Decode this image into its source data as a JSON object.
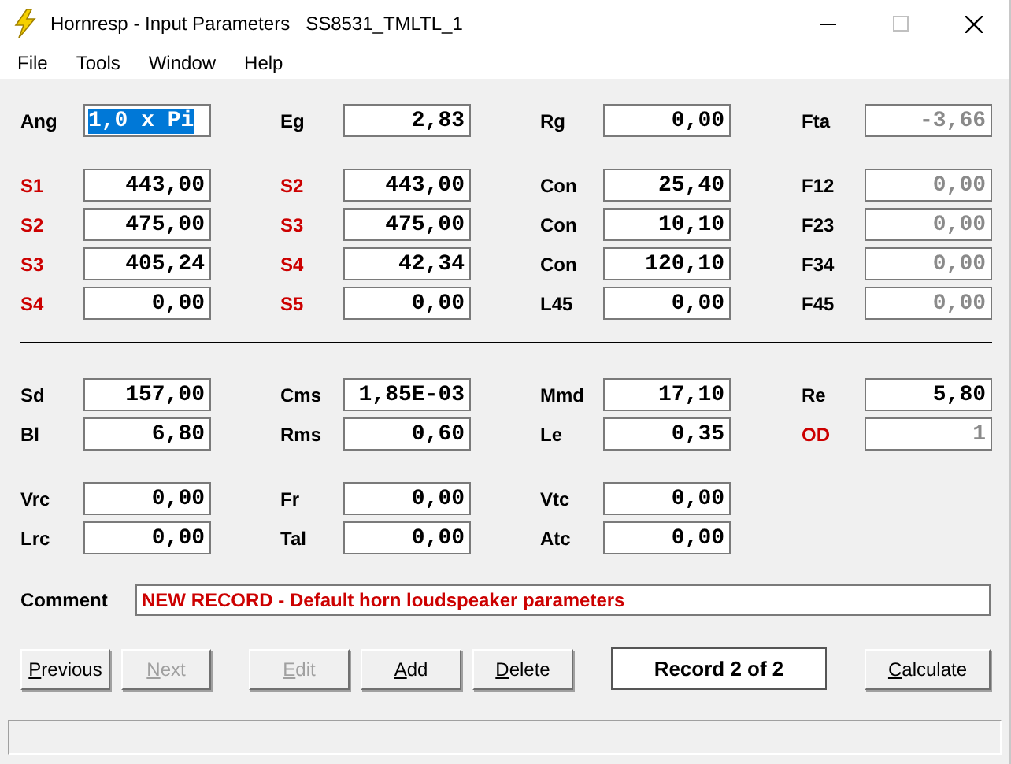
{
  "window": {
    "title": "Hornresp - Input Parameters",
    "document": "SS8531_TMLTL_1"
  },
  "menu": [
    "File",
    "Tools",
    "Window",
    "Help"
  ],
  "groups": [
    {
      "divider_before": false,
      "rows": [
        [
          {
            "label": "Ang",
            "color": "#000000",
            "value": "1,0 x Pi",
            "disabled": false,
            "selected": true
          },
          {
            "label": "Eg",
            "color": "#000000",
            "value": "2,83",
            "disabled": false,
            "selected": false
          },
          {
            "label": "Rg",
            "color": "#000000",
            "value": "0,00",
            "disabled": false,
            "selected": false
          },
          {
            "label": "Fta",
            "color": "#000000",
            "value": "-3,66",
            "disabled": true,
            "selected": false
          }
        ]
      ]
    },
    {
      "divider_before": false,
      "rows": [
        [
          {
            "label": "S1",
            "color": "#cc0000",
            "value": "443,00",
            "disabled": false,
            "selected": false
          },
          {
            "label": "S2",
            "color": "#cc0000",
            "value": "443,00",
            "disabled": false,
            "selected": false
          },
          {
            "label": "Con",
            "color": "#000000",
            "value": "25,40",
            "disabled": false,
            "selected": false
          },
          {
            "label": "F12",
            "color": "#000000",
            "value": "0,00",
            "disabled": true,
            "selected": false
          }
        ],
        [
          {
            "label": "S2",
            "color": "#cc0000",
            "value": "475,00",
            "disabled": false,
            "selected": false
          },
          {
            "label": "S3",
            "color": "#cc0000",
            "value": "475,00",
            "disabled": false,
            "selected": false
          },
          {
            "label": "Con",
            "color": "#000000",
            "value": "10,10",
            "disabled": false,
            "selected": false
          },
          {
            "label": "F23",
            "color": "#000000",
            "value": "0,00",
            "disabled": true,
            "selected": false
          }
        ],
        [
          {
            "label": "S3",
            "color": "#cc0000",
            "value": "405,24",
            "disabled": false,
            "selected": false
          },
          {
            "label": "S4",
            "color": "#cc0000",
            "value": "42,34",
            "disabled": false,
            "selected": false
          },
          {
            "label": "Con",
            "color": "#000000",
            "value": "120,10",
            "disabled": false,
            "selected": false
          },
          {
            "label": "F34",
            "color": "#000000",
            "value": "0,00",
            "disabled": true,
            "selected": false
          }
        ],
        [
          {
            "label": "S4",
            "color": "#cc0000",
            "value": "0,00",
            "disabled": false,
            "selected": false
          },
          {
            "label": "S5",
            "color": "#cc0000",
            "value": "0,00",
            "disabled": false,
            "selected": false
          },
          {
            "label": "L45",
            "color": "#000000",
            "value": "0,00",
            "disabled": false,
            "selected": false
          },
          {
            "label": "F45",
            "color": "#000000",
            "value": "0,00",
            "disabled": true,
            "selected": false
          }
        ]
      ]
    },
    {
      "divider_before": true,
      "rows": [
        [
          {
            "label": "Sd",
            "color": "#000000",
            "value": "157,00",
            "disabled": false,
            "selected": false
          },
          {
            "label": "Cms",
            "color": "#000000",
            "value": "1,85E-03",
            "disabled": false,
            "selected": false
          },
          {
            "label": "Mmd",
            "color": "#000000",
            "value": "17,10",
            "disabled": false,
            "selected": false
          },
          {
            "label": "Re",
            "color": "#000000",
            "value": "5,80",
            "disabled": false,
            "selected": false
          }
        ],
        [
          {
            "label": "Bl",
            "color": "#000000",
            "value": "6,80",
            "disabled": false,
            "selected": false
          },
          {
            "label": "Rms",
            "color": "#000000",
            "value": "0,60",
            "disabled": false,
            "selected": false
          },
          {
            "label": "Le",
            "color": "#000000",
            "value": "0,35",
            "disabled": false,
            "selected": false
          },
          {
            "label": "OD",
            "color": "#cc0000",
            "value": "1",
            "disabled": true,
            "selected": false
          }
        ]
      ]
    },
    {
      "divider_before": false,
      "rows": [
        [
          {
            "label": "Vrc",
            "color": "#000000",
            "value": "0,00",
            "disabled": false,
            "selected": false
          },
          {
            "label": "Fr",
            "color": "#000000",
            "value": "0,00",
            "disabled": false,
            "selected": false
          },
          {
            "label": "Vtc",
            "color": "#000000",
            "value": "0,00",
            "disabled": false,
            "selected": false
          }
        ],
        [
          {
            "label": "Lrc",
            "color": "#000000",
            "value": "0,00",
            "disabled": false,
            "selected": false
          },
          {
            "label": "Tal",
            "color": "#000000",
            "value": "0,00",
            "disabled": false,
            "selected": false
          },
          {
            "label": "Atc",
            "color": "#000000",
            "value": "0,00",
            "disabled": false,
            "selected": false
          }
        ]
      ]
    }
  ],
  "comment": {
    "label": "Comment",
    "value": "NEW RECORD - Default horn loudspeaker parameters"
  },
  "buttons": [
    {
      "kind": "button",
      "label": "Previous",
      "disabled": false
    },
    {
      "kind": "button",
      "label": "Next",
      "disabled": true
    },
    {
      "kind": "spacer"
    },
    {
      "kind": "button",
      "label": "Edit",
      "disabled": true
    },
    {
      "kind": "button",
      "label": "Add",
      "disabled": false
    },
    {
      "kind": "button",
      "label": "Delete",
      "disabled": false
    },
    {
      "kind": "display",
      "label": "Record 2 of 2"
    },
    {
      "kind": "button",
      "label": "Calculate",
      "disabled": false
    }
  ]
}
